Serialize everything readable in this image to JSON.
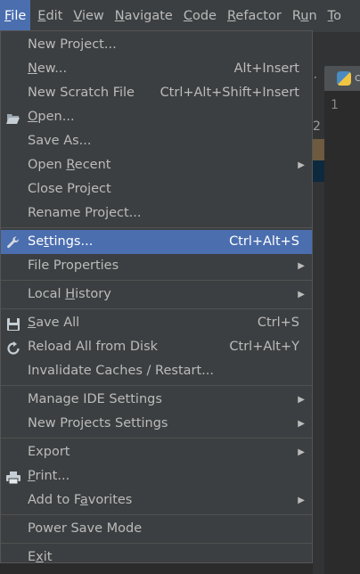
{
  "menubar": {
    "items": [
      {
        "pre": "",
        "mnemo": "F",
        "post": "ile"
      },
      {
        "pre": "",
        "mnemo": "E",
        "post": "dit"
      },
      {
        "pre": "",
        "mnemo": "V",
        "post": "iew"
      },
      {
        "pre": "",
        "mnemo": "N",
        "post": "avigate"
      },
      {
        "pre": "",
        "mnemo": "C",
        "post": "ode"
      },
      {
        "pre": "",
        "mnemo": "R",
        "post": "efactor"
      },
      {
        "pre": "R",
        "mnemo": "u",
        "post": "n"
      },
      {
        "pre": "",
        "mnemo": "T",
        "post": "o"
      }
    ]
  },
  "editor": {
    "tab_text": "c",
    "line_number": "1",
    "side_number": "2",
    "dots": "·"
  },
  "file_menu": {
    "new_project": "New Project...",
    "new": {
      "pre": "",
      "mnemo": "N",
      "post": "ew...",
      "shortcut": "Alt+Insert"
    },
    "new_scratch": {
      "label": "New Scratch File",
      "shortcut": "Ctrl+Alt+Shift+Insert"
    },
    "open": {
      "pre": "",
      "mnemo": "O",
      "post": "pen...",
      "icon": "folder-open-icon"
    },
    "save_as": "Save As...",
    "open_recent": {
      "pre": "Open ",
      "mnemo": "R",
      "post": "ecent"
    },
    "close_project": "Close Project",
    "rename_project": "Rename Project...",
    "settings": {
      "pre": "Se",
      "mnemo": "t",
      "post": "tings...",
      "shortcut": "Ctrl+Alt+S",
      "icon": "wrench-icon"
    },
    "file_properties": "File Properties",
    "local_history": {
      "pre": "Local ",
      "mnemo": "H",
      "post": "istory"
    },
    "save_all": {
      "pre": "",
      "mnemo": "S",
      "post": "ave All",
      "shortcut": "Ctrl+S",
      "icon": "floppy-icon"
    },
    "reload_all": {
      "label": "Reload All from Disk",
      "shortcut": "Ctrl+Alt+Y",
      "icon": "reload-icon"
    },
    "invalidate_caches": "Invalidate Caches / Restart...",
    "manage_ide": "Manage IDE Settings",
    "new_projects_settings": "New Projects Settings",
    "export": "Export",
    "print": {
      "pre": "",
      "mnemo": "P",
      "post": "rint...",
      "icon": "printer-icon"
    },
    "add_to_favorites": {
      "pre": "Add to F",
      "mnemo": "a",
      "post": "vorites"
    },
    "power_save": "Power Save Mode",
    "exit": {
      "pre": "E",
      "mnemo": "x",
      "post": "it"
    }
  },
  "colors": {
    "menu_bg": "#3c3f41",
    "selection": "#4b6eaf",
    "text": "#bbbbbb"
  }
}
